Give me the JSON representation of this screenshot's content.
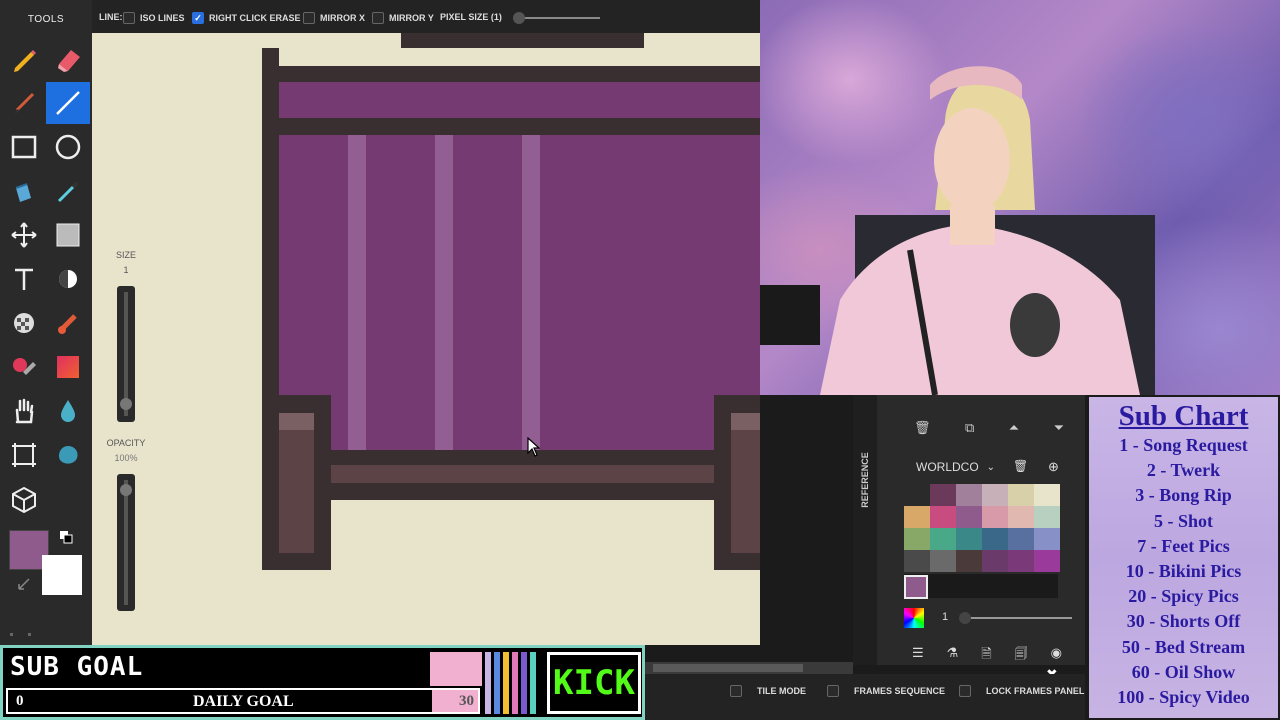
{
  "toolbar": {
    "title": "TOOLS",
    "size_label": "SIZE",
    "size_value": "1",
    "opacity_label": "OPACITY",
    "opacity_value": "100%",
    "primary_color": "#8f5a8c",
    "secondary_color": "#ffffff",
    "active_tool": "line-tool"
  },
  "options": {
    "line_label": "LINE:",
    "iso_lines": "ISO LINES",
    "right_click_erase": "RIGHT CLICK ERASE",
    "mirror_x": "MIRROR X",
    "mirror_y": "MIRROR Y",
    "pixel_size": "PIXEL SIZE (1)",
    "iso_lines_checked": false,
    "right_click_erase_checked": true,
    "mirror_x_checked": false,
    "mirror_y_checked": false
  },
  "panel": {
    "reference_tab": "REFERENCE",
    "palette_name": "WORLDCO",
    "opacity_value": "1",
    "selected_color": "#8f5a8c",
    "palette_rows": [
      [
        "#2a2a2a",
        "#6b3a5a",
        "#a0809a",
        "#c8b0b8",
        "#d8d0a8",
        "#e8e4cc"
      ],
      [
        "#d8a868",
        "#c84c80",
        "#8f5a8c",
        "#d89aa8",
        "#e0b8b0",
        "#b8d0c0"
      ],
      [
        "#88a868",
        "#48a888",
        "#3a8888",
        "#3a6888",
        "#5870a0",
        "#8890c8"
      ],
      [
        "#4a4a4a",
        "#6a6a6a",
        "#4a3a3a",
        "#6a3a6a",
        "#7a3a7a",
        "#9a3a9a"
      ]
    ],
    "footer": {
      "tile_mode": "TILE MODE",
      "frames_sequence": "FRAMES SEQUENCE",
      "lock_frames_panel": "LOCK FRAMES PANEL"
    }
  },
  "subchart": {
    "title": "Sub Chart",
    "items": [
      "1 - Song Request",
      "2 - Twerk",
      "3 - Bong Rip",
      "5 - Shot",
      "7 - Feet Pics",
      "10 - Bikini Pics",
      "20 - Spicy Pics",
      "30 - Shorts Off",
      "50 - Bed Stream",
      "60 - Oil Show",
      "100 - Spicy Video"
    ]
  },
  "subgoal": {
    "title": "SUB GOAL",
    "current": "0",
    "label": "DAILY GOAL",
    "target": "30",
    "kick": "KICK"
  },
  "colors": {
    "canvas_bg": "#e8e4cc",
    "bed_dark": "#3a2f30",
    "bed_wood": "#5c4446",
    "bed_wood_light": "#7a6062",
    "blanket": "#763a72",
    "blanket_stripe": "#935e92",
    "accent": "#1e6fe0"
  }
}
